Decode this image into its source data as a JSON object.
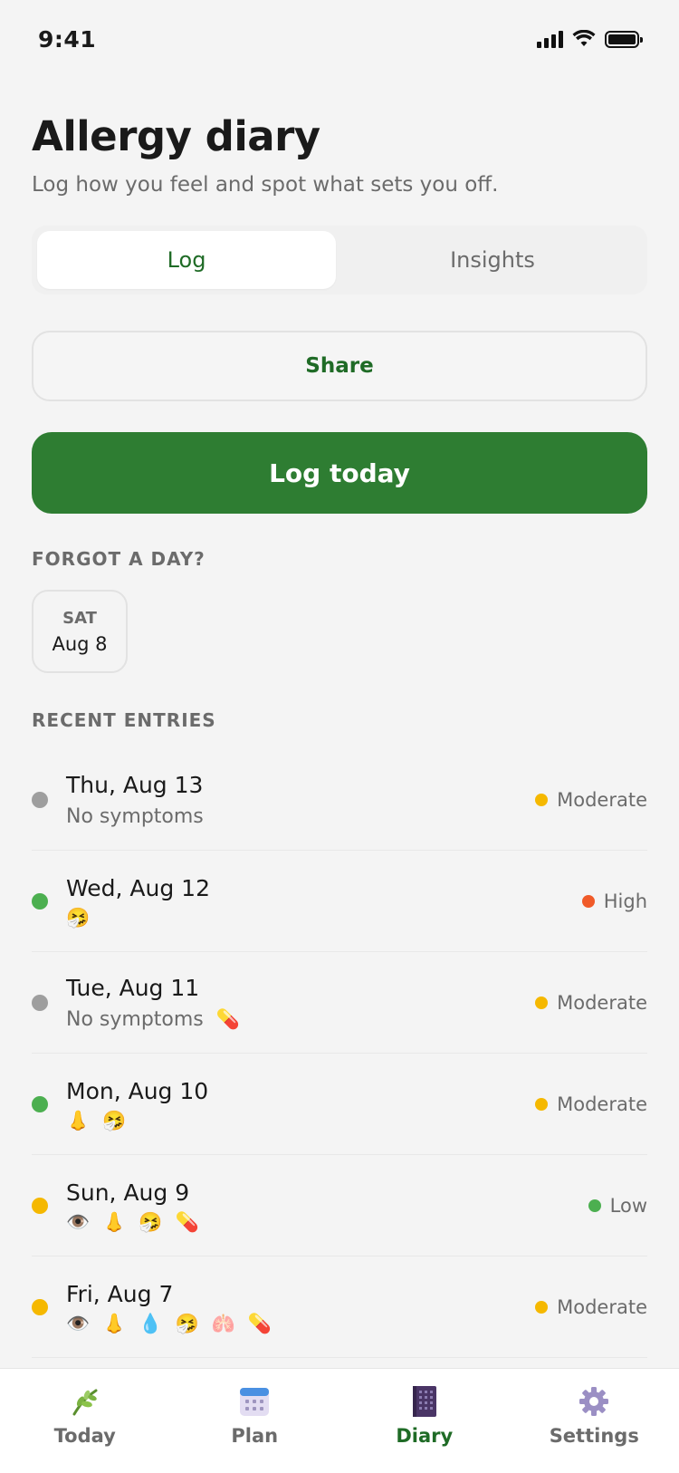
{
  "status": {
    "time": "9:41"
  },
  "header": {
    "title": "Allergy diary",
    "subtitle": "Log how you feel and spot what sets you off."
  },
  "tabs": [
    {
      "label": "Log",
      "active": true
    },
    {
      "label": "Insights",
      "active": false
    }
  ],
  "actions": {
    "share_label": "Share",
    "log_today_label": "Log today"
  },
  "forgot": {
    "section_label": "FORGOT A DAY?",
    "days": [
      {
        "dow": "SAT",
        "date": "Aug 8"
      }
    ]
  },
  "recent": {
    "section_label": "RECENT ENTRIES",
    "entries": [
      {
        "date": "Thu, Aug 13",
        "status_color": "#9e9e9e",
        "text": "No symptoms",
        "icons": [],
        "level": "Moderate",
        "level_color": "#f5b800"
      },
      {
        "date": "Wed, Aug 12",
        "status_color": "#4caf50",
        "text": "",
        "icons": [
          "sneeze-icon"
        ],
        "level": "High",
        "level_color": "#f05a28"
      },
      {
        "date": "Tue, Aug 11",
        "status_color": "#9e9e9e",
        "text": "No symptoms",
        "icons": [
          "pill-icon"
        ],
        "level": "Moderate",
        "level_color": "#f5b800"
      },
      {
        "date": "Mon, Aug 10",
        "status_color": "#4caf50",
        "text": "",
        "icons": [
          "nose-icon",
          "sneeze-icon"
        ],
        "level": "Moderate",
        "level_color": "#f5b800"
      },
      {
        "date": "Sun, Aug 9",
        "status_color": "#f5b800",
        "text": "",
        "icons": [
          "eye-icon",
          "nose-icon",
          "sneeze-icon",
          "pill-icon"
        ],
        "level": "Low",
        "level_color": "#4caf50"
      },
      {
        "date": "Fri, Aug 7",
        "status_color": "#f5b800",
        "text": "",
        "icons": [
          "eye-icon",
          "nose-icon",
          "droplet-icon",
          "sneeze-icon",
          "lungs-icon",
          "pill-icon"
        ],
        "level": "Moderate",
        "level_color": "#f5b800"
      }
    ]
  },
  "icon_glyphs": {
    "eye-icon": "👁️",
    "nose-icon": "👃",
    "droplet-icon": "💧",
    "sneeze-icon": "🤧",
    "lungs-icon": "🫁",
    "pill-icon": "💊"
  },
  "tabbar": [
    {
      "label": "Today",
      "icon": "leaf-icon",
      "active": false
    },
    {
      "label": "Plan",
      "icon": "calendar-icon",
      "active": false
    },
    {
      "label": "Diary",
      "icon": "diary-icon",
      "active": true
    },
    {
      "label": "Settings",
      "icon": "gear-icon",
      "active": false
    }
  ],
  "colors": {
    "accent": "#2e7d32",
    "accent_text": "#1f6b26",
    "background": "#f4f4f4"
  }
}
